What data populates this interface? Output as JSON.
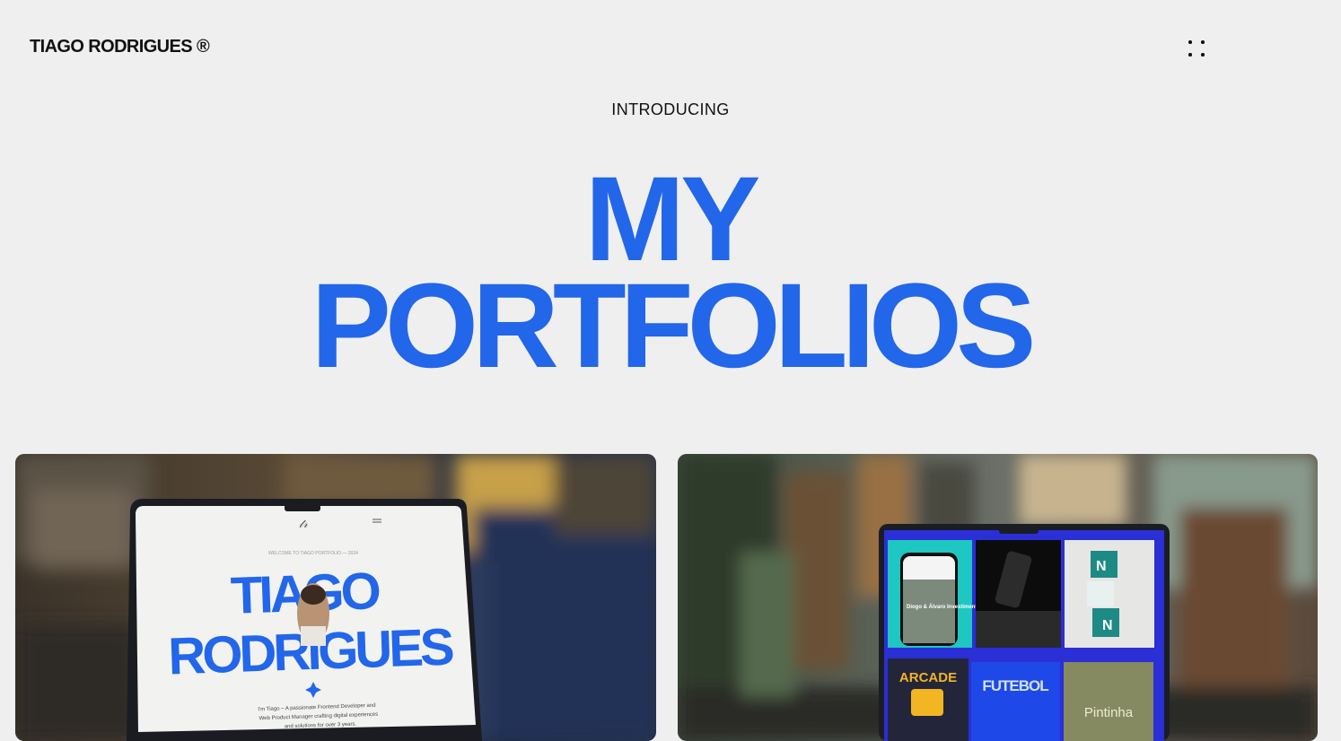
{
  "header": {
    "brand": "TIAGO RODRIGUES ®",
    "menu_icon": "dots-grid-icon"
  },
  "hero": {
    "eyebrow": "INTRODUCING",
    "title_line1": "MY",
    "title_line2": "PORTFOLIOS"
  },
  "cards": [
    {
      "screen": {
        "meta": "WELCOME TO TIAGO PORTFOLIO — 2024",
        "name_line1": "TIAGO",
        "name_line2": "RODRIGUES",
        "bio": [
          "I'm Tiago – A passionate Frontend Developer and",
          "Web Product Manager crafting digital experiences",
          "and solutions for over 3 years."
        ]
      }
    },
    {
      "screen": {
        "tile_heading": "Diogo & Álvaro Investimento Imobiliário",
        "arcade": "ARCADE",
        "football": "FUTEBOL",
        "pintinha": "Pintinha"
      }
    }
  ],
  "colors": {
    "accent": "#2266ea",
    "background": "#efefef",
    "text": "#111111"
  }
}
